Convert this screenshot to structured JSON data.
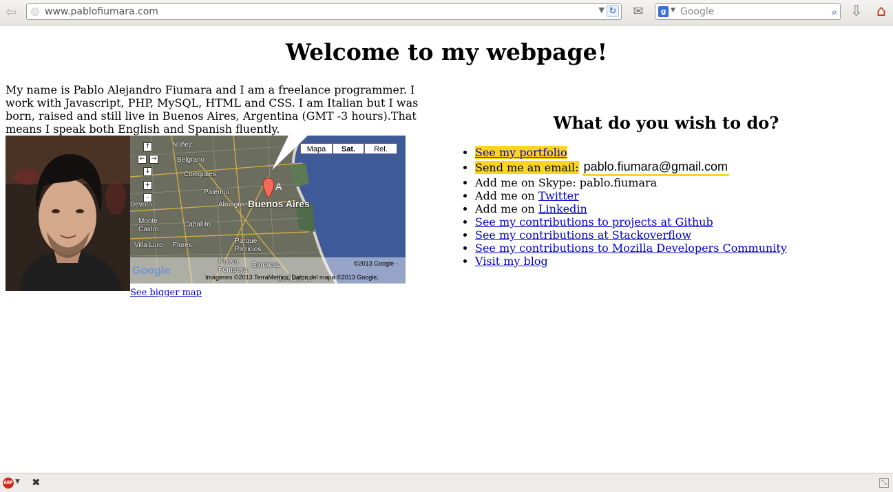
{
  "browser": {
    "url": "www.pablofiumara.com",
    "search_placeholder": "Google"
  },
  "page": {
    "title": "Welcome to my webpage!",
    "intro": "My name is Pablo Alejandro Fiumara and I am a freelance programmer. I work with Javascript, PHP, MySQL, HTML and CSS. I am Italian but I was born, raised and still live in Buenos Aires, Argentina (GMT -3 hours).That means I speak both English and Spanish fluently.",
    "bigger_map_link": "See bigger map",
    "map": {
      "type_buttons": [
        "Mapa",
        "Sat.",
        "Rel."
      ],
      "active_type": "Sat.",
      "marker_label": "A",
      "labels": {
        "nunez": "Núñez",
        "belgrano": "Belgrano",
        "colegiales": "Colegiales",
        "palermo": "Palermo",
        "almagro": "Almagro",
        "buenos_aires": "Buenos Aires",
        "devoto": "Devoto",
        "monte_castro": "Monte Castro",
        "caballito": "Caballito",
        "villa_luro": "Villa Luro",
        "flores": "Flores",
        "parque_patricios": "Parque Patricios",
        "nueva_pompeya": "Nueva Pompeya",
        "barracas": "Barracas",
        "avellaneda": "Avellaneda"
      },
      "copyright": "©2013 Google -",
      "attribution": "Imágenes ©2013 TerraMetrics, Datos del mapa ©2013 Google,",
      "logo_text": "Google"
    },
    "actions_heading": "What do you wish to do?",
    "actions": {
      "portfolio": "See my portfolio",
      "email_label": "Send me an email:",
      "email_value": "pablo.fiumara@gmail.com",
      "skype": "Add me on Skype: pablo.fiumara",
      "twitter_prefix": "Add me on",
      "twitter_link": "Twitter",
      "linkedin_prefix": "Add me on",
      "linkedin_link": "Linkedin",
      "github": "See my contributions to projects at Github",
      "stackoverflow": "See my contributions at Stackoverflow",
      "mozilla": "See my contributions to Mozilla Developers Community",
      "blog": "Visit my blog"
    }
  },
  "statusbar": {
    "abp_label": "ABP"
  },
  "colors": {
    "highlight": "#ffd41f",
    "link": "#0000cc"
  }
}
